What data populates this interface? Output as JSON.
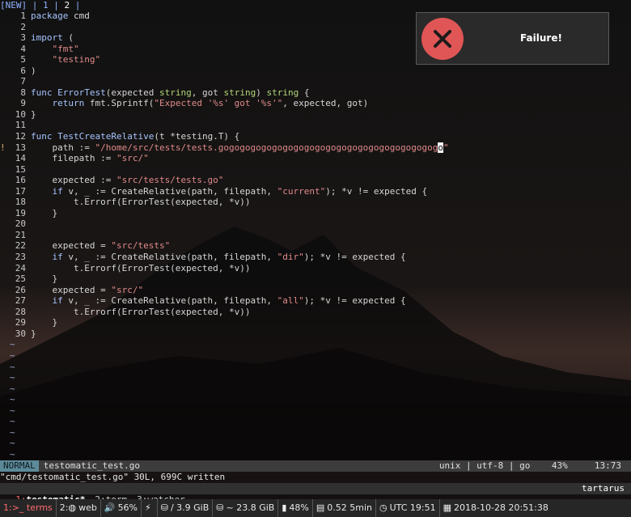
{
  "tabline": {
    "new_label": "[NEW]",
    "tab1": "1",
    "tab2": "2"
  },
  "editor": {
    "lines": [
      {
        "n": "1",
        "sign": "",
        "segs": [
          [
            "kw",
            "package"
          ],
          [
            "code",
            " cmd"
          ]
        ]
      },
      {
        "n": "2",
        "sign": "",
        "segs": []
      },
      {
        "n": "3",
        "sign": "",
        "segs": [
          [
            "kw",
            "import"
          ],
          [
            "code",
            " ("
          ]
        ]
      },
      {
        "n": "4",
        "sign": "",
        "segs": [
          [
            "code",
            "    "
          ],
          [
            "str",
            "\"fmt\""
          ]
        ]
      },
      {
        "n": "5",
        "sign": "",
        "segs": [
          [
            "code",
            "    "
          ],
          [
            "str",
            "\"testing\""
          ]
        ]
      },
      {
        "n": "6",
        "sign": "",
        "segs": [
          [
            "code",
            ")"
          ]
        ]
      },
      {
        "n": "7",
        "sign": "",
        "segs": []
      },
      {
        "n": "8",
        "sign": "",
        "segs": [
          [
            "kw",
            "func"
          ],
          [
            "code",
            " "
          ],
          [
            "fn",
            "ErrorTest"
          ],
          [
            "code",
            "(expected "
          ],
          [
            "typ",
            "string"
          ],
          [
            "code",
            ", got "
          ],
          [
            "typ",
            "string"
          ],
          [
            "code",
            ") "
          ],
          [
            "typ",
            "string"
          ],
          [
            "code",
            " {"
          ]
        ]
      },
      {
        "n": "9",
        "sign": "",
        "segs": [
          [
            "code",
            "    "
          ],
          [
            "kw",
            "return"
          ],
          [
            "code",
            " fmt.Sprintf("
          ],
          [
            "str",
            "\"Expected '%s' got '%s'\""
          ],
          [
            "code",
            ", expected, got)"
          ]
        ]
      },
      {
        "n": "10",
        "sign": "",
        "segs": [
          [
            "code",
            "}"
          ]
        ]
      },
      {
        "n": "11",
        "sign": "",
        "segs": []
      },
      {
        "n": "12",
        "sign": "",
        "segs": [
          [
            "kw",
            "func"
          ],
          [
            "code",
            " "
          ],
          [
            "fn",
            "TestCreateRelative"
          ],
          [
            "code",
            "(t *testing.T) {"
          ]
        ]
      },
      {
        "n": "13",
        "sign": "!",
        "segs": [
          [
            "code",
            "    path := "
          ],
          [
            "str",
            "\"/home/src/tests/tests.gogogogogogogogogogogogogogogogogogogogog"
          ],
          [
            "cursor",
            "o"
          ],
          [
            "str",
            "\""
          ]
        ]
      },
      {
        "n": "14",
        "sign": "",
        "segs": [
          [
            "code",
            "    filepath := "
          ],
          [
            "str",
            "\"src/\""
          ]
        ]
      },
      {
        "n": "15",
        "sign": "",
        "segs": []
      },
      {
        "n": "16",
        "sign": "",
        "segs": [
          [
            "code",
            "    expected := "
          ],
          [
            "str",
            "\"src/tests/tests.go\""
          ]
        ]
      },
      {
        "n": "17",
        "sign": "",
        "segs": [
          [
            "code",
            "    "
          ],
          [
            "kw",
            "if"
          ],
          [
            "code",
            " v, _ := CreateRelative(path, filepath, "
          ],
          [
            "str",
            "\"current\""
          ],
          [
            "code",
            "); *v != expected {"
          ]
        ]
      },
      {
        "n": "18",
        "sign": "",
        "segs": [
          [
            "code",
            "        t.Errorf(ErrorTest(expected, *v))"
          ]
        ]
      },
      {
        "n": "19",
        "sign": "",
        "segs": [
          [
            "code",
            "    }"
          ]
        ]
      },
      {
        "n": "20",
        "sign": "",
        "segs": []
      },
      {
        "n": "21",
        "sign": "",
        "segs": []
      },
      {
        "n": "22",
        "sign": "",
        "segs": [
          [
            "code",
            "    expected = "
          ],
          [
            "str",
            "\"src/tests\""
          ]
        ]
      },
      {
        "n": "23",
        "sign": "",
        "segs": [
          [
            "code",
            "    "
          ],
          [
            "kw",
            "if"
          ],
          [
            "code",
            " v, _ := CreateRelative(path, filepath, "
          ],
          [
            "str",
            "\"dir\""
          ],
          [
            "code",
            "); *v != expected {"
          ]
        ]
      },
      {
        "n": "24",
        "sign": "",
        "segs": [
          [
            "code",
            "        t.Errorf(ErrorTest(expected, *v))"
          ]
        ]
      },
      {
        "n": "25",
        "sign": "",
        "segs": [
          [
            "code",
            "    }"
          ]
        ]
      },
      {
        "n": "26",
        "sign": "",
        "segs": [
          [
            "code",
            "    expected = "
          ],
          [
            "str",
            "\"src/\""
          ]
        ]
      },
      {
        "n": "27",
        "sign": "",
        "segs": [
          [
            "code",
            "    "
          ],
          [
            "kw",
            "if"
          ],
          [
            "code",
            " v, _ := CreateRelative(path, filepath, "
          ],
          [
            "str",
            "\"all\""
          ],
          [
            "code",
            "); *v != expected {"
          ]
        ]
      },
      {
        "n": "28",
        "sign": "",
        "segs": [
          [
            "code",
            "        t.Errorf(ErrorTest(expected, *v))"
          ]
        ]
      },
      {
        "n": "29",
        "sign": "",
        "segs": [
          [
            "code",
            "    }"
          ]
        ]
      },
      {
        "n": "30",
        "sign": "",
        "segs": [
          [
            "code",
            "}"
          ]
        ]
      }
    ],
    "tilde": "~",
    "tilde_count": 11
  },
  "notification": {
    "message": "Failure!",
    "icon": "close-icon",
    "icon_color": "#e05555"
  },
  "statusline": {
    "mode": "NORMAL",
    "filename": "testomatic_test.go",
    "right": "unix | utf-8 | go    43%     13:73"
  },
  "cmdline": "\"cmd/testomatic_test.go\" 30L, 699C written",
  "tmux": {
    "windows": [
      {
        "index": "1:",
        "name": "testomatic*",
        "active": true
      },
      {
        "index": "2:",
        "name": "term",
        "active": false
      },
      {
        "index": "3:",
        "name": "watcher",
        "active": false
      }
    ],
    "host": "tartarus"
  },
  "sysbar": {
    "workspace1": "1:>_ terms",
    "workspace2": "2:",
    "web": "web",
    "volume": "56%",
    "disk_root": "/ 3.9 GiB",
    "disk_home": "~ 23.8 GiB",
    "battery": "48%",
    "load": "0.52 5min",
    "clock_utc": "UTC 19:51",
    "datetime": "2018-10-28 20:51:38"
  }
}
